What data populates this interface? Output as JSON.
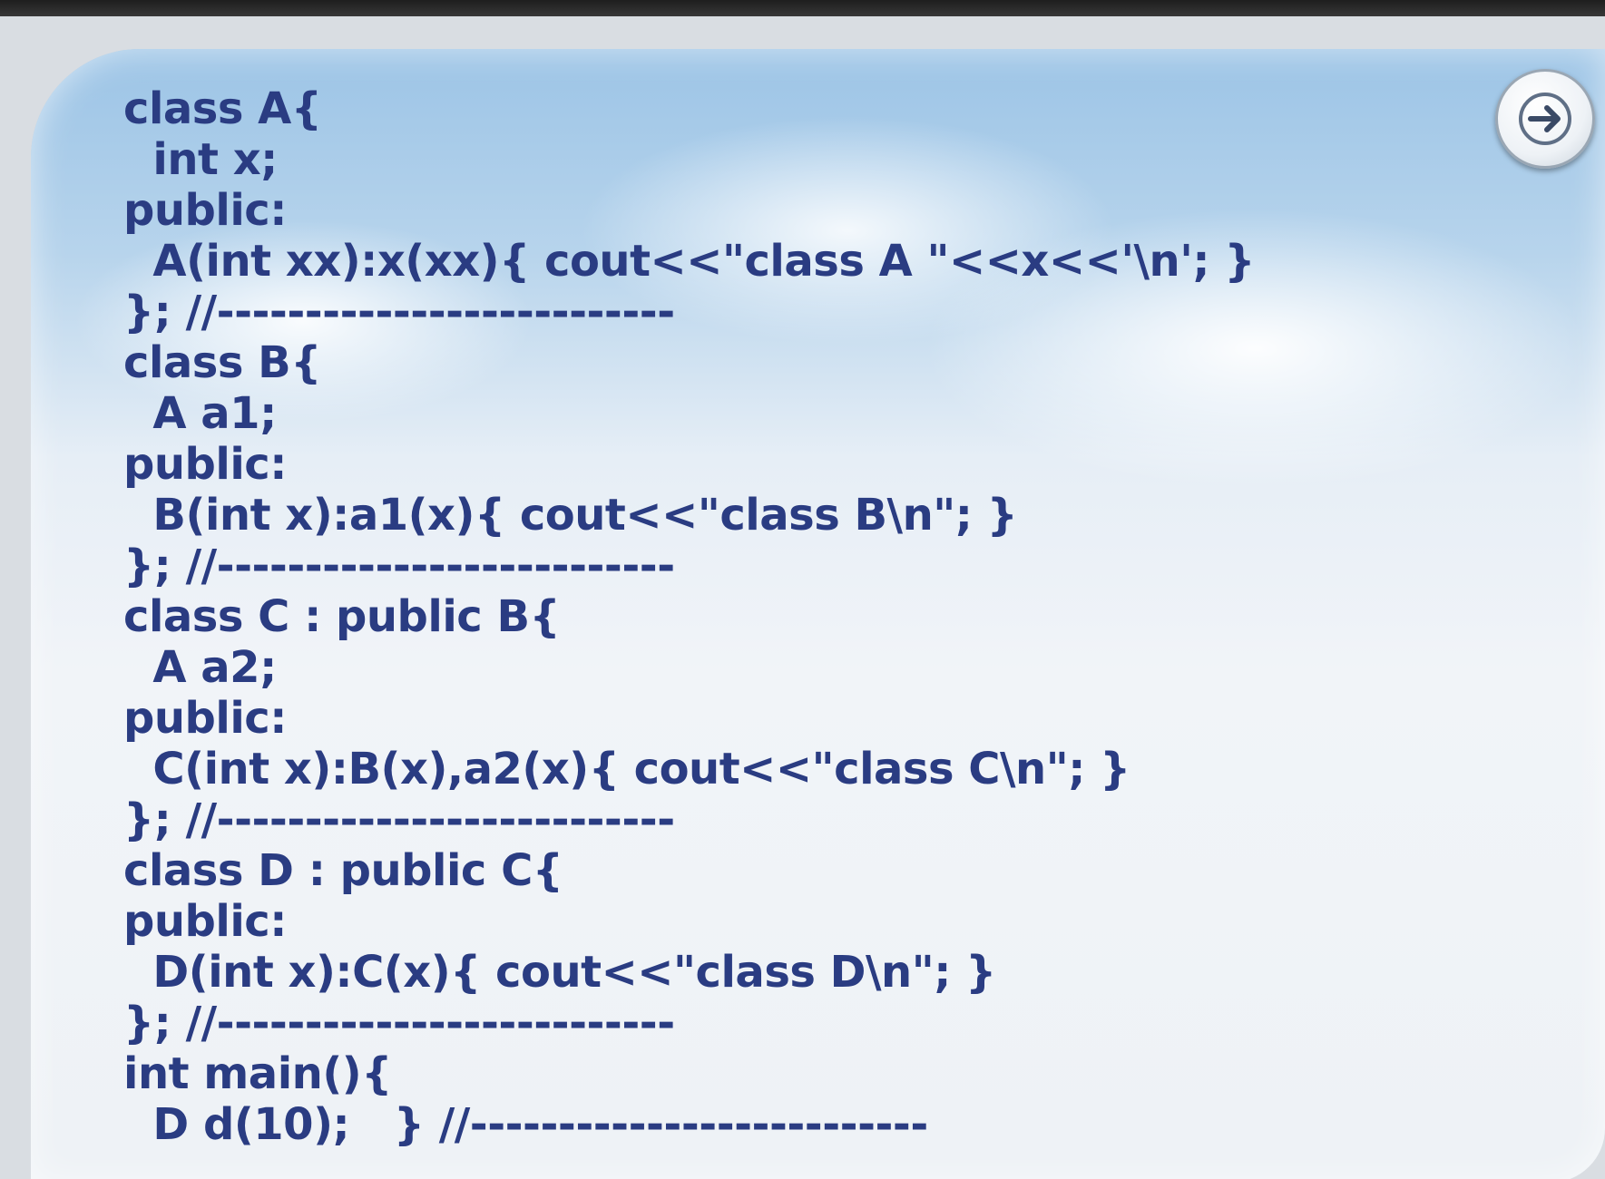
{
  "slide": {
    "code_lines": [
      "class A{",
      "  int x;",
      "public:",
      "  A(int xx):x(xx){ cout<<\"class A \"<<x<<'\\n'; }",
      "}; //--------------------------",
      "class B{",
      "  A a1;",
      "public:",
      "  B(int x):a1(x){ cout<<\"class B\\n\"; }",
      "}; //--------------------------",
      "class C : public B{",
      "  A a2;",
      "public:",
      "  C(int x):B(x),a2(x){ cout<<\"class C\\n\"; }",
      "}; //--------------------------",
      "class D : public C{",
      "public:",
      "  D(int x):C(x){ cout<<\"class D\\n\"; }",
      "}; //--------------------------",
      "int main(){",
      "  D d(10);   } //--------------------------"
    ],
    "nav_button_icon": "arrow-right-icon",
    "code_color": "#2a3c82"
  }
}
